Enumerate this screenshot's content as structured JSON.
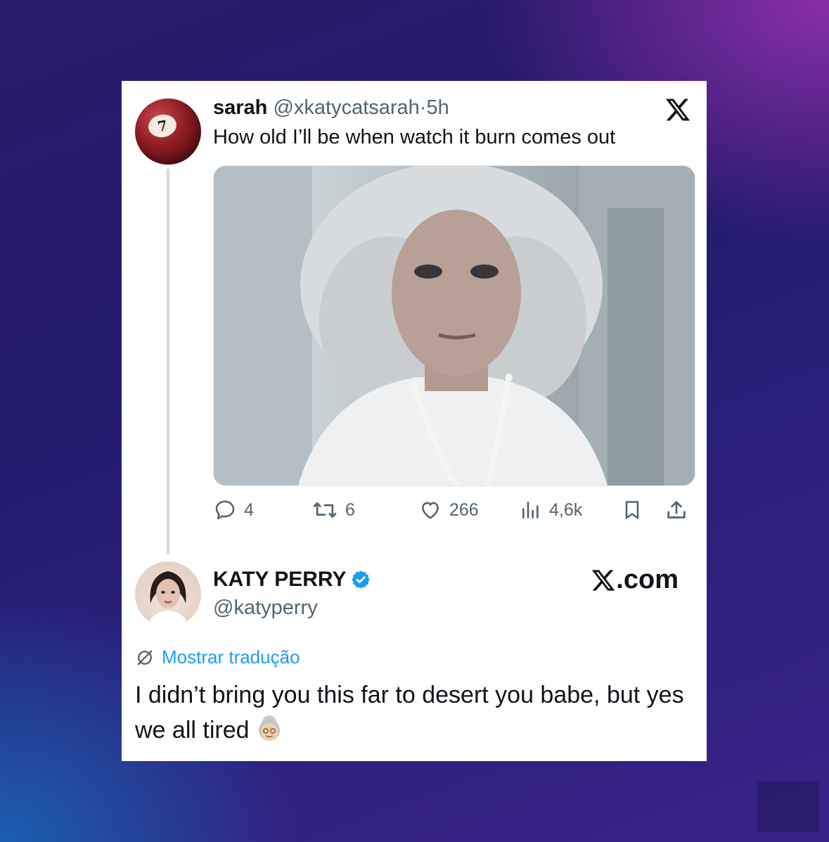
{
  "tweet": {
    "author_name": "sarah",
    "author_handle": "@xkatycatsarah",
    "separator": "·",
    "time": "5h",
    "text": "How old I’ll be when watch it burn comes out",
    "avatar_ball_number": "7",
    "stats": {
      "replies": "4",
      "reposts": "6",
      "likes": "266",
      "views": "4,6k"
    }
  },
  "reply": {
    "author_name": "KATY PERRY",
    "author_handle": "@katyperry",
    "verified": true,
    "translate_label": "Mostrar tradução",
    "text": "I didn’t bring you this far to desert you babe, but yes we all tired"
  },
  "branding": {
    "site": ".com"
  },
  "colors": {
    "link_blue": "#1d9bf0",
    "secondary_text": "#536471",
    "primary_text": "#0f1419"
  }
}
